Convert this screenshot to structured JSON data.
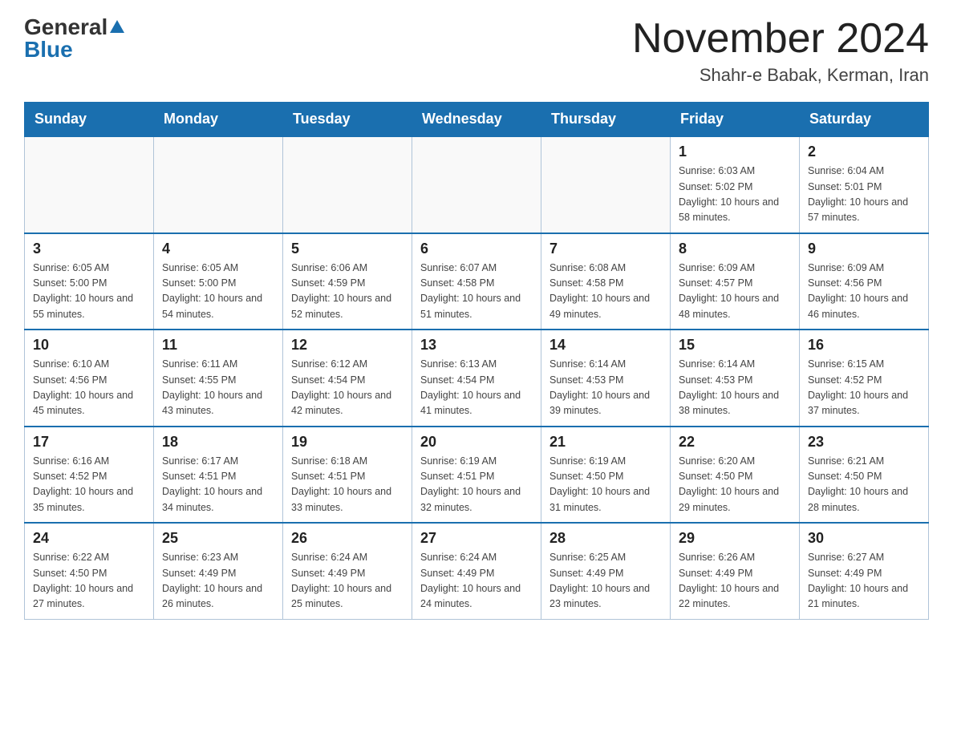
{
  "header": {
    "logo_general": "General",
    "logo_blue": "Blue",
    "title": "November 2024",
    "subtitle": "Shahr-e Babak, Kerman, Iran"
  },
  "weekdays": [
    "Sunday",
    "Monday",
    "Tuesday",
    "Wednesday",
    "Thursday",
    "Friday",
    "Saturday"
  ],
  "weeks": [
    [
      {
        "day": null,
        "info": null
      },
      {
        "day": null,
        "info": null
      },
      {
        "day": null,
        "info": null
      },
      {
        "day": null,
        "info": null
      },
      {
        "day": null,
        "info": null
      },
      {
        "day": "1",
        "info": "Sunrise: 6:03 AM\nSunset: 5:02 PM\nDaylight: 10 hours and 58 minutes."
      },
      {
        "day": "2",
        "info": "Sunrise: 6:04 AM\nSunset: 5:01 PM\nDaylight: 10 hours and 57 minutes."
      }
    ],
    [
      {
        "day": "3",
        "info": "Sunrise: 6:05 AM\nSunset: 5:00 PM\nDaylight: 10 hours and 55 minutes."
      },
      {
        "day": "4",
        "info": "Sunrise: 6:05 AM\nSunset: 5:00 PM\nDaylight: 10 hours and 54 minutes."
      },
      {
        "day": "5",
        "info": "Sunrise: 6:06 AM\nSunset: 4:59 PM\nDaylight: 10 hours and 52 minutes."
      },
      {
        "day": "6",
        "info": "Sunrise: 6:07 AM\nSunset: 4:58 PM\nDaylight: 10 hours and 51 minutes."
      },
      {
        "day": "7",
        "info": "Sunrise: 6:08 AM\nSunset: 4:58 PM\nDaylight: 10 hours and 49 minutes."
      },
      {
        "day": "8",
        "info": "Sunrise: 6:09 AM\nSunset: 4:57 PM\nDaylight: 10 hours and 48 minutes."
      },
      {
        "day": "9",
        "info": "Sunrise: 6:09 AM\nSunset: 4:56 PM\nDaylight: 10 hours and 46 minutes."
      }
    ],
    [
      {
        "day": "10",
        "info": "Sunrise: 6:10 AM\nSunset: 4:56 PM\nDaylight: 10 hours and 45 minutes."
      },
      {
        "day": "11",
        "info": "Sunrise: 6:11 AM\nSunset: 4:55 PM\nDaylight: 10 hours and 43 minutes."
      },
      {
        "day": "12",
        "info": "Sunrise: 6:12 AM\nSunset: 4:54 PM\nDaylight: 10 hours and 42 minutes."
      },
      {
        "day": "13",
        "info": "Sunrise: 6:13 AM\nSunset: 4:54 PM\nDaylight: 10 hours and 41 minutes."
      },
      {
        "day": "14",
        "info": "Sunrise: 6:14 AM\nSunset: 4:53 PM\nDaylight: 10 hours and 39 minutes."
      },
      {
        "day": "15",
        "info": "Sunrise: 6:14 AM\nSunset: 4:53 PM\nDaylight: 10 hours and 38 minutes."
      },
      {
        "day": "16",
        "info": "Sunrise: 6:15 AM\nSunset: 4:52 PM\nDaylight: 10 hours and 37 minutes."
      }
    ],
    [
      {
        "day": "17",
        "info": "Sunrise: 6:16 AM\nSunset: 4:52 PM\nDaylight: 10 hours and 35 minutes."
      },
      {
        "day": "18",
        "info": "Sunrise: 6:17 AM\nSunset: 4:51 PM\nDaylight: 10 hours and 34 minutes."
      },
      {
        "day": "19",
        "info": "Sunrise: 6:18 AM\nSunset: 4:51 PM\nDaylight: 10 hours and 33 minutes."
      },
      {
        "day": "20",
        "info": "Sunrise: 6:19 AM\nSunset: 4:51 PM\nDaylight: 10 hours and 32 minutes."
      },
      {
        "day": "21",
        "info": "Sunrise: 6:19 AM\nSunset: 4:50 PM\nDaylight: 10 hours and 31 minutes."
      },
      {
        "day": "22",
        "info": "Sunrise: 6:20 AM\nSunset: 4:50 PM\nDaylight: 10 hours and 29 minutes."
      },
      {
        "day": "23",
        "info": "Sunrise: 6:21 AM\nSunset: 4:50 PM\nDaylight: 10 hours and 28 minutes."
      }
    ],
    [
      {
        "day": "24",
        "info": "Sunrise: 6:22 AM\nSunset: 4:50 PM\nDaylight: 10 hours and 27 minutes."
      },
      {
        "day": "25",
        "info": "Sunrise: 6:23 AM\nSunset: 4:49 PM\nDaylight: 10 hours and 26 minutes."
      },
      {
        "day": "26",
        "info": "Sunrise: 6:24 AM\nSunset: 4:49 PM\nDaylight: 10 hours and 25 minutes."
      },
      {
        "day": "27",
        "info": "Sunrise: 6:24 AM\nSunset: 4:49 PM\nDaylight: 10 hours and 24 minutes."
      },
      {
        "day": "28",
        "info": "Sunrise: 6:25 AM\nSunset: 4:49 PM\nDaylight: 10 hours and 23 minutes."
      },
      {
        "day": "29",
        "info": "Sunrise: 6:26 AM\nSunset: 4:49 PM\nDaylight: 10 hours and 22 minutes."
      },
      {
        "day": "30",
        "info": "Sunrise: 6:27 AM\nSunset: 4:49 PM\nDaylight: 10 hours and 21 minutes."
      }
    ]
  ]
}
